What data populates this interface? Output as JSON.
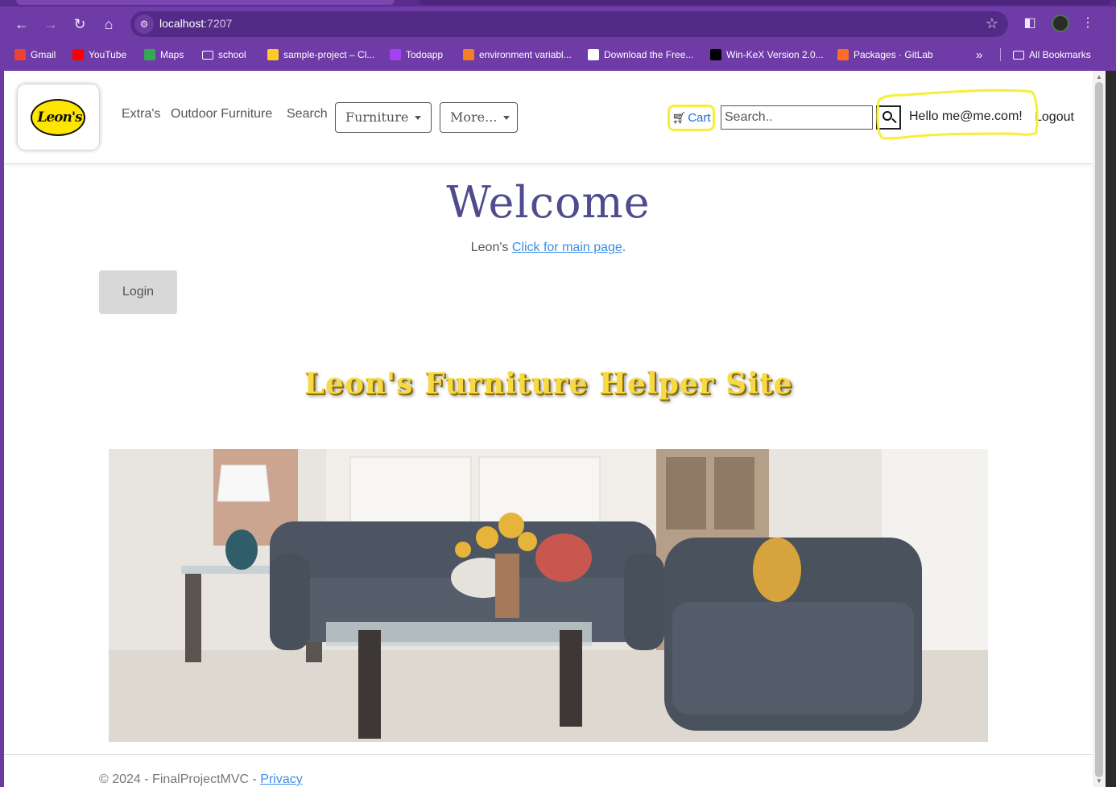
{
  "browser": {
    "url_host": "localhost",
    "url_port": ":7207",
    "bookmarks": [
      {
        "label": "Gmail",
        "icon": "gmail-icon",
        "color": "#ea4335"
      },
      {
        "label": "YouTube",
        "icon": "youtube-icon",
        "color": "#ff0000"
      },
      {
        "label": "Maps",
        "icon": "maps-icon",
        "color": "#34a853"
      },
      {
        "label": "school",
        "icon": "folder-icon",
        "color": "#ffffff"
      },
      {
        "label": "sample-project – Cl...",
        "icon": "firebase-icon",
        "color": "#ffca28"
      },
      {
        "label": "Todoapp",
        "icon": "todoapp-icon",
        "color": "#a142f4"
      },
      {
        "label": "environment variabl...",
        "icon": "stack-icon",
        "color": "#f48024"
      },
      {
        "label": "Download the Free...",
        "icon": "eye-icon",
        "color": "#ffffff"
      },
      {
        "label": "Win-KeX Version 2.0...",
        "icon": "kali-icon",
        "color": "#000000"
      },
      {
        "label": "Packages · GitLab",
        "icon": "gitlab-icon",
        "color": "#fc6d26"
      }
    ],
    "overflow": "»",
    "all_bookmarks": "All Bookmarks"
  },
  "navbar": {
    "logo_text": "Leon's",
    "links": [
      "Extra's",
      "Outdoor Furniture",
      "Search"
    ],
    "dropdowns": [
      "Furniture",
      "More..."
    ],
    "cart_label": "Cart",
    "search_placeholder": "Search..",
    "greeting": "Hello me@me.com!",
    "logout": "Logout"
  },
  "main": {
    "welcome": "Welcome",
    "sub_prefix": "Leon's ",
    "sub_link": "Click for main page",
    "sub_suffix": ".",
    "login_button": "Login",
    "helper_title": "Leon's Furniture Helper Site"
  },
  "footer": {
    "copyright": "© 2024 - FinalProjectMVC - ",
    "privacy": "Privacy"
  },
  "colors": {
    "browser_frame": "#6f3ba6",
    "welcome_text": "#4f4c8e",
    "link": "#3a8ee6",
    "highlight": "#f5ef3a",
    "logo_yellow": "#ffe600"
  }
}
